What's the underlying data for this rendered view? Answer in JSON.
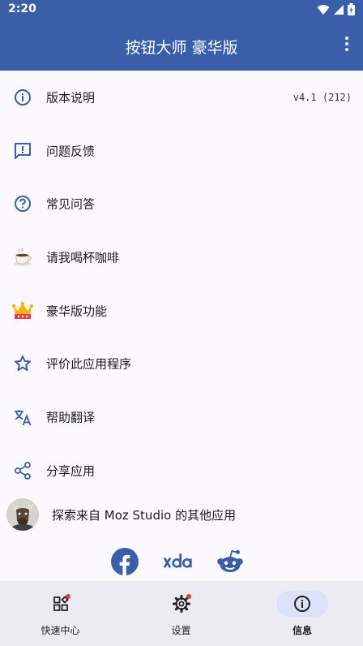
{
  "status_bar": {
    "time": "2:20"
  },
  "app_bar": {
    "title": "按钮大师 豪华版"
  },
  "menu": [
    {
      "label": "版本说明",
      "value": "v4.1 (212)",
      "icon": "info-icon"
    },
    {
      "label": "问题反馈",
      "icon": "feedback-icon"
    },
    {
      "label": "常见问答",
      "icon": "help-icon"
    },
    {
      "label": "请我喝杯咖啡",
      "icon": "coffee-icon"
    },
    {
      "label": "豪华版功能",
      "icon": "crown-icon"
    },
    {
      "label": "评价此应用程序",
      "icon": "star-icon"
    },
    {
      "label": "帮助翻译",
      "icon": "translate-icon"
    },
    {
      "label": "分享应用",
      "icon": "share-icon"
    }
  ],
  "studio": {
    "label": "探索来自 Moz Studio 的其他应用",
    "icon": "moose-avatar"
  },
  "social": [
    "facebook-icon",
    "xda-icon",
    "reddit-icon"
  ],
  "bottom_nav": [
    {
      "label": "快速中心",
      "icon": "widgets-icon",
      "badge": true
    },
    {
      "label": "设置",
      "icon": "settings-icon",
      "badge": true
    },
    {
      "label": "信息",
      "icon": "info-icon",
      "active": true
    }
  ],
  "colors": {
    "primary": "#3a5fa8",
    "icon": "#3a5fa8",
    "badge": "#e53935"
  }
}
